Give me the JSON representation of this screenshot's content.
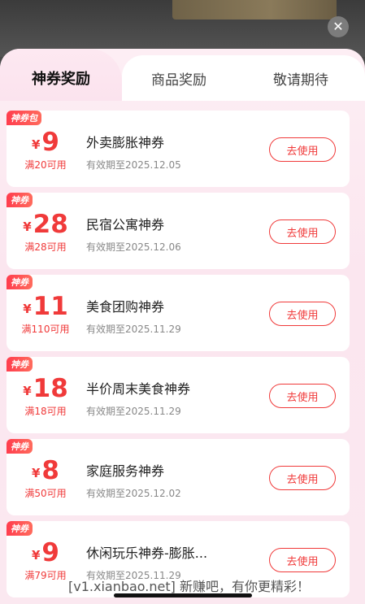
{
  "tabs": [
    {
      "label": "神券奖励",
      "active": true
    },
    {
      "label": "商品奖励",
      "active": false
    },
    {
      "label": "敬请期待",
      "active": false
    }
  ],
  "coupons": [
    {
      "badge": "神券包",
      "currency": "¥",
      "amount": "9",
      "condition": "满20可用",
      "name": "外卖膨胀神券",
      "expiry": "有效期至2025.12.05",
      "button": "去使用"
    },
    {
      "badge": "神券",
      "currency": "¥",
      "amount": "28",
      "condition": "满28可用",
      "name": "民宿公寓神券",
      "expiry": "有效期至2025.12.06",
      "button": "去使用"
    },
    {
      "badge": "神券",
      "currency": "¥",
      "amount": "11",
      "condition": "满110可用",
      "name": "美食团购神券",
      "expiry": "有效期至2025.11.29",
      "button": "去使用"
    },
    {
      "badge": "神券",
      "currency": "¥",
      "amount": "18",
      "condition": "满18可用",
      "name": "半价周末美食神券",
      "expiry": "有效期至2025.11.29",
      "button": "去使用"
    },
    {
      "badge": "神券",
      "currency": "¥",
      "amount": "8",
      "condition": "满50可用",
      "name": "家庭服务神券",
      "expiry": "有效期至2025.12.02",
      "button": "去使用"
    },
    {
      "badge": "神券",
      "currency": "¥",
      "amount": "9",
      "condition": "满79可用",
      "name": "休闲玩乐神券-膨胀...",
      "expiry": "有效期至2025.11.29",
      "button": "去使用"
    }
  ],
  "watermark": "[v1.xianbao.net] 新赚吧，有你更精彩！",
  "colors": {
    "accent": "#f03a3a",
    "sheet_bg": "#fdeef4"
  },
  "icons": {
    "close": "close-icon"
  }
}
